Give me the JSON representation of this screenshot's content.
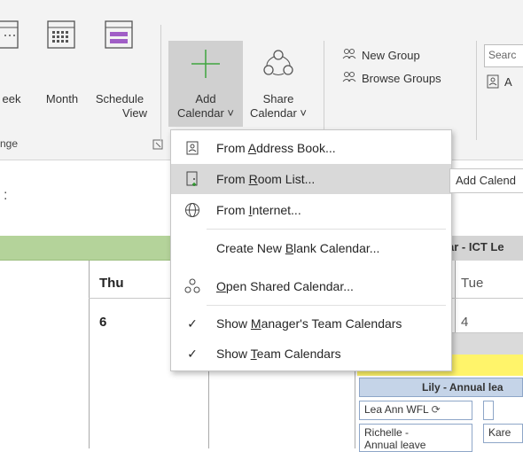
{
  "ribbon": {
    "week_label": "eek",
    "month_label": "Month",
    "schedule_label_1": "Schedule",
    "schedule_label_2": "View",
    "arrange_group": "nge",
    "add_calendar_1": "Add",
    "add_calendar_2": "Calendar ˅",
    "share_calendar_1": "Share",
    "share_calendar_2": "Calendar ˅",
    "new_group": "New Group",
    "browse_groups": "Browse Groups",
    "search_placeholder": "Searc",
    "address_short": "A"
  },
  "calendar": {
    "date_fragment": ":",
    "right_header": "ar - ICT Le",
    "thu_label": "Thu",
    "thu_num": "6",
    "tue_label": "Tue",
    "tue_num": "4",
    "lily": "Lily - Annual lea",
    "appt_1": "Lea Ann WFL",
    "appt_2": "Richelle -",
    "appt_2b": "Annual leave",
    "appt_3": "Kare"
  },
  "menu": {
    "items": [
      {
        "pre": "From ",
        "u": "A",
        "post": "ddress Book..."
      },
      {
        "pre": "From ",
        "u": "R",
        "post": "oom List..."
      },
      {
        "pre": "From ",
        "u": "I",
        "post": "nternet..."
      },
      {
        "pre": "Create New ",
        "u": "B",
        "post": "lank Calendar..."
      },
      {
        "pre": "",
        "u": "O",
        "post": "pen Shared Calendar..."
      },
      {
        "pre": "Show ",
        "u": "M",
        "post": "anager's Team Calendars"
      },
      {
        "pre": "Show ",
        "u": "T",
        "post": "eam Calendars"
      }
    ]
  },
  "tooltip": "Add Calend",
  "colors": {
    "green_header": "#b4d39a",
    "hover": "#d9d9d9",
    "yellow": "#fff46a",
    "lily_blue": "#c5d4e8"
  }
}
